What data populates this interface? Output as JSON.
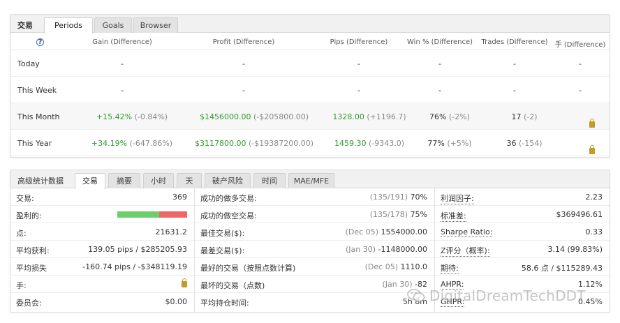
{
  "periods_panel": {
    "title": "交易",
    "tabs": [
      "Periods",
      "Goals",
      "Browser"
    ],
    "active_tab": "Periods",
    "help_icon": "?",
    "headers": [
      "Gain (Difference)",
      "Profit (Difference)",
      "Pips (Difference)",
      "Win % (Difference)",
      "Trades (Difference)",
      "手 (Difference)"
    ],
    "rows": [
      {
        "label": "Today",
        "gain": "-",
        "gain_diff": "",
        "profit": "-",
        "profit_diff": "",
        "pips": "-",
        "pips_diff": "",
        "win": "-",
        "win_diff": "",
        "trades": "-",
        "trades_diff": "",
        "lots": "-"
      },
      {
        "label": "This Week",
        "gain": "-",
        "gain_diff": "",
        "profit": "-",
        "profit_diff": "",
        "pips": "-",
        "pips_diff": "",
        "win": "-",
        "win_diff": "",
        "trades": "-",
        "trades_diff": "",
        "lots": "-"
      },
      {
        "label": "This Month",
        "gain": "+15.42%",
        "gain_diff": "(-0.84%)",
        "profit": "$1456000.00",
        "profit_diff": "(-$205800.00)",
        "pips": "1328.00",
        "pips_diff": "(+1196.7)",
        "win": "76%",
        "win_diff": "(-2%)",
        "trades": "17",
        "trades_diff": "(-2)",
        "lots": "lock"
      },
      {
        "label": "This Year",
        "gain": "+34.19%",
        "gain_diff": "(-647.86%)",
        "profit": "$3117800.00",
        "profit_diff": "(-$19387200.00)",
        "pips": "1459.30",
        "pips_diff": "(-9343.0)",
        "win": "77%",
        "win_diff": "(+5%)",
        "trades": "36",
        "trades_diff": "(-154)",
        "lots": "lock"
      }
    ]
  },
  "stats_panel": {
    "title": "高级统计数据",
    "tabs": [
      "交易",
      "摘要",
      "小时",
      "天",
      "破产风险",
      "时间",
      "MAE/MFE"
    ],
    "active_tab": "交易",
    "col1": [
      {
        "key": "交易:",
        "value": "369"
      },
      {
        "key": "盈利的:",
        "value": "",
        "win_fraction": 0.6
      },
      {
        "key": "点:",
        "value": "21631.2"
      },
      {
        "key": "平均获利:",
        "value": "139.05 pips / $285205.93"
      },
      {
        "key": "平均损失",
        "value": "-160.74 pips / -$348119.19"
      },
      {
        "key": "手:",
        "value": "lock"
      },
      {
        "key": "委员会:",
        "value": "$0.00"
      }
    ],
    "col2": [
      {
        "key": "成功的做多交易:",
        "note": "(135/191)",
        "value": "70%"
      },
      {
        "key": "成功的做空交易:",
        "note": "(135/178)",
        "value": "75%"
      },
      {
        "key": "最佳交易($):",
        "note": "(Dec 05)",
        "value": "1554000.00"
      },
      {
        "key": "最差交易($):",
        "note": "(Jan 30)",
        "value": "-1148000.00"
      },
      {
        "key": "最好的交易（按照点数计算)",
        "note": "(Dec 05)",
        "value": "1110.0"
      },
      {
        "key": "最坏的交易（点数)",
        "note": "(Jan 30)",
        "value": "-82"
      },
      {
        "key": "平均持仓时间:",
        "note": "",
        "value": "5h 8m"
      }
    ],
    "col3": [
      {
        "key": "利润因子:",
        "value": "2.23"
      },
      {
        "key": "标准差:",
        "value": "$369496.61"
      },
      {
        "key": "Sharpe Ratio:",
        "value": "0.33"
      },
      {
        "key": "Z评分（概率):",
        "value": "3.14 (99.83%)"
      },
      {
        "key": "期待:",
        "value": "58.6 点 / $115289.43"
      },
      {
        "key": "AHPR:",
        "value": "1.12%"
      },
      {
        "key": "GHPR:",
        "value": "0.45%"
      }
    ]
  },
  "watermark": "DigitalDreamTechDDT",
  "colors": {
    "green": "#2e9a2e",
    "loss": "#ee6666",
    "win": "#6cce6c"
  }
}
